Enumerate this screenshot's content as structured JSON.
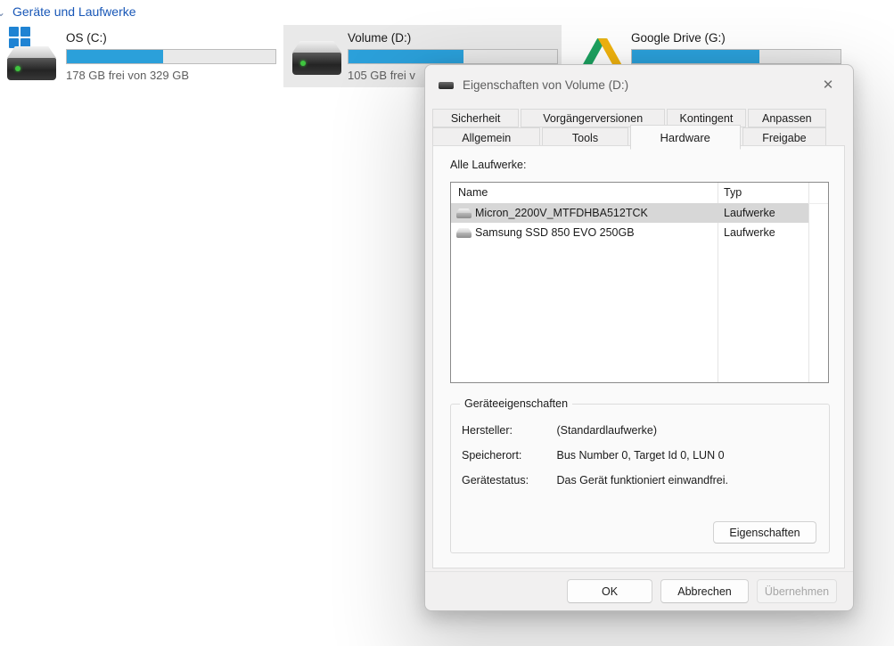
{
  "explorer": {
    "section_header": "Geräte und Laufwerke",
    "chevron_glyph": "⌄",
    "drives": [
      {
        "name": "OS (C:)",
        "caption": "178 GB frei von 329 GB",
        "fill_width": "46%",
        "icon": "windows-drive"
      },
      {
        "name": "Volume (D:)",
        "caption": "105 GB frei v",
        "fill_width": "55%",
        "icon": "drive",
        "selected": true
      },
      {
        "name": "Google Drive (G:)",
        "caption": "",
        "fill_width": "61%",
        "icon": "google-drive"
      }
    ],
    "accent_colors": {
      "link_blue": "#1857b7",
      "bar_fill": "#2ba0da",
      "windows_logo_blue": "#1f83d3"
    }
  },
  "dialog": {
    "title": "Eigenschaften von Volume (D:)",
    "close_glyph": "✕",
    "tabs_row1": [
      {
        "label": "Sicherheit"
      },
      {
        "label": "Vorgängerversionen"
      },
      {
        "label": "Kontingent"
      },
      {
        "label": "Anpassen"
      }
    ],
    "tabs_row2": [
      {
        "label": "Allgemein"
      },
      {
        "label": "Tools"
      },
      {
        "label": "Hardware",
        "active": true
      },
      {
        "label": "Freigabe"
      }
    ],
    "hardware_tab": {
      "list_label": "Alle Laufwerke:",
      "columns": {
        "name": "Name",
        "type": "Typ"
      },
      "rows": [
        {
          "name": "Micron_2200V_MTFDHBA512TCK",
          "type": "Laufwerke",
          "selected": true
        },
        {
          "name": "Samsung SSD 850 EVO 250GB",
          "type": "Laufwerke"
        }
      ],
      "device_properties": {
        "legend": "Geräteeigenschaften",
        "rows": [
          {
            "label": "Hersteller:",
            "value": "(Standardlaufwerke)"
          },
          {
            "label": "Speicherort:",
            "value": "Bus Number 0, Target Id 0, LUN 0"
          },
          {
            "label": "Gerätestatus:",
            "value": "Das Gerät funktioniert einwandfrei."
          }
        ],
        "properties_button": "Eigenschaften"
      }
    },
    "footer": {
      "ok": "OK",
      "cancel": "Abbrechen",
      "apply": "Übernehmen",
      "apply_enabled": false
    }
  }
}
